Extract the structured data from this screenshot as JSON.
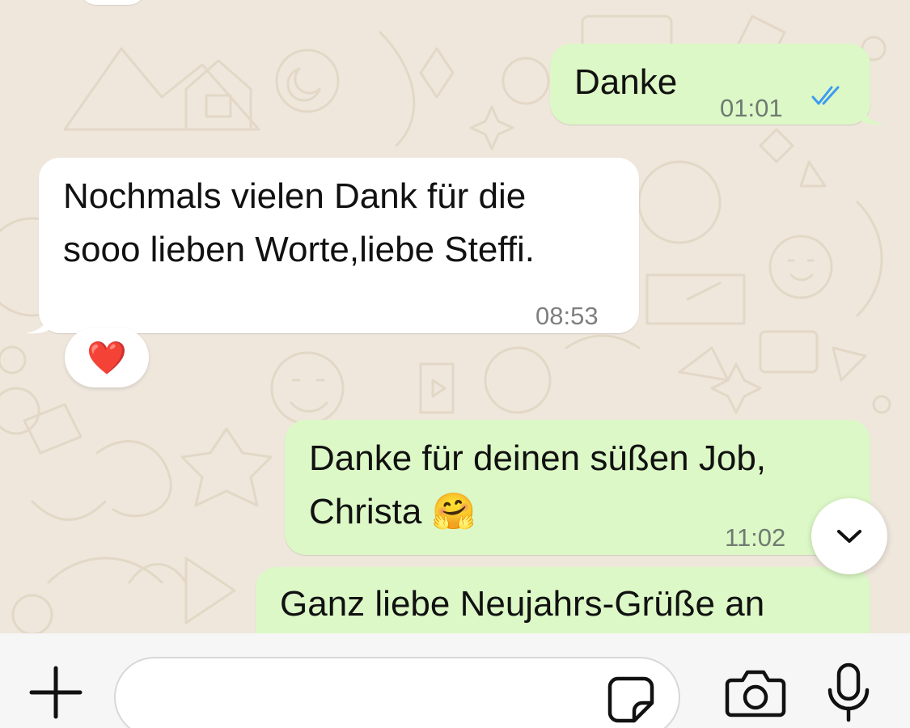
{
  "colors": {
    "wallpaper": "#efe7dc",
    "outgoing_bubble": "#dcf8c6",
    "incoming_bubble": "#ffffff",
    "read_ticks": "#3d9bf0",
    "icon_dark": "#111111"
  },
  "messages": [
    {
      "direction": "outgoing",
      "lines": [
        "Danke"
      ],
      "time": "01:01",
      "status": "read"
    },
    {
      "direction": "incoming",
      "lines": [
        "Nochmals vielen Dank für die",
        "sooo lieben Worte,liebe Steffi."
      ],
      "time": "08:53",
      "reaction": "❤️"
    },
    {
      "direction": "outgoing",
      "lines": [
        "Danke für deinen süßen Job,",
        "Christa 🤗"
      ],
      "time": "11:02",
      "status": "read"
    },
    {
      "direction": "outgoing",
      "lines": [
        "Ganz liebe Neujahrs-Grüße an"
      ]
    }
  ],
  "composer": {
    "input_value": "",
    "icons": {
      "attach": "plus-icon",
      "sticker": "sticker-icon",
      "camera": "camera-icon",
      "microphone": "microphone-icon"
    }
  },
  "scroll_to_bottom": {
    "icon": "chevron-down-icon"
  }
}
